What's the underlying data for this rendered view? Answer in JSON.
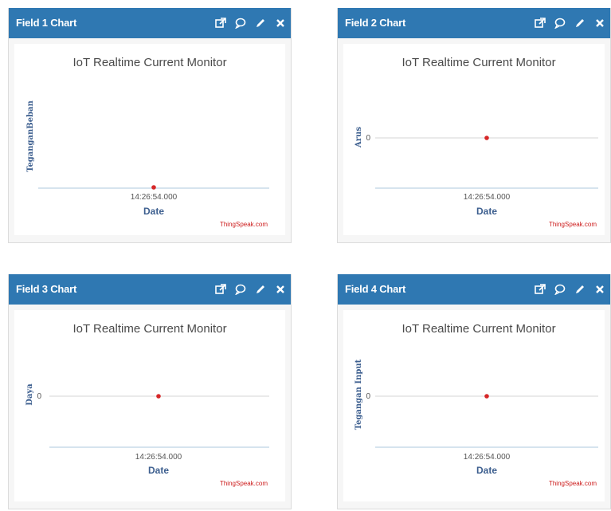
{
  "widgets": [
    {
      "title": "Field 1 Chart",
      "chart_title": "IoT Realtime Current Monitor",
      "ylabel": "TeganganBeban",
      "xlabel": "Date",
      "xtick": "14:26:54.000",
      "ytick": "",
      "credit": "ThingSpeak.com"
    },
    {
      "title": "Field 2 Chart",
      "chart_title": "IoT Realtime Current Monitor",
      "ylabel": "Arus",
      "xlabel": "Date",
      "xtick": "14:26:54.000",
      "ytick": "0",
      "credit": "ThingSpeak.com"
    },
    {
      "title": "Field 3 Chart",
      "chart_title": "IoT Realtime Current Monitor",
      "ylabel": "Daya",
      "xlabel": "Date",
      "xtick": "14:26:54.000",
      "ytick": "0",
      "credit": "ThingSpeak.com"
    },
    {
      "title": "Field 4 Chart",
      "chart_title": "IoT Realtime Current Monitor",
      "ylabel": "Tegangan Input",
      "xlabel": "Date",
      "xtick": "14:26:54.000",
      "ytick": "0",
      "credit": "ThingSpeak.com"
    }
  ],
  "header_icons": [
    "external-link-icon",
    "comment-icon",
    "pencil-icon",
    "close-icon"
  ],
  "colors": {
    "header": "#2f78b2",
    "point": "#d62728",
    "axis_label": "#3d5f8f",
    "credit": "#cc1a1a"
  },
  "chart_data": [
    {
      "type": "line",
      "title": "IoT Realtime Current Monitor",
      "xlabel": "Date",
      "ylabel": "TeganganBeban",
      "series": [
        {
          "points": [
            {
              "x": "14:26:54.000",
              "y": null
            }
          ]
        }
      ]
    },
    {
      "type": "line",
      "title": "IoT Realtime Current Monitor",
      "xlabel": "Date",
      "ylabel": "Arus",
      "series": [
        {
          "points": [
            {
              "x": "14:26:54.000",
              "y": 0
            }
          ]
        }
      ]
    },
    {
      "type": "line",
      "title": "IoT Realtime Current Monitor",
      "xlabel": "Date",
      "ylabel": "Daya",
      "series": [
        {
          "points": [
            {
              "x": "14:26:54.000",
              "y": 0
            }
          ]
        }
      ]
    },
    {
      "type": "line",
      "title": "IoT Realtime Current Monitor",
      "xlabel": "Date",
      "ylabel": "Tegangan Input",
      "series": [
        {
          "points": [
            {
              "x": "14:26:54.000",
              "y": 0
            }
          ]
        }
      ]
    }
  ]
}
